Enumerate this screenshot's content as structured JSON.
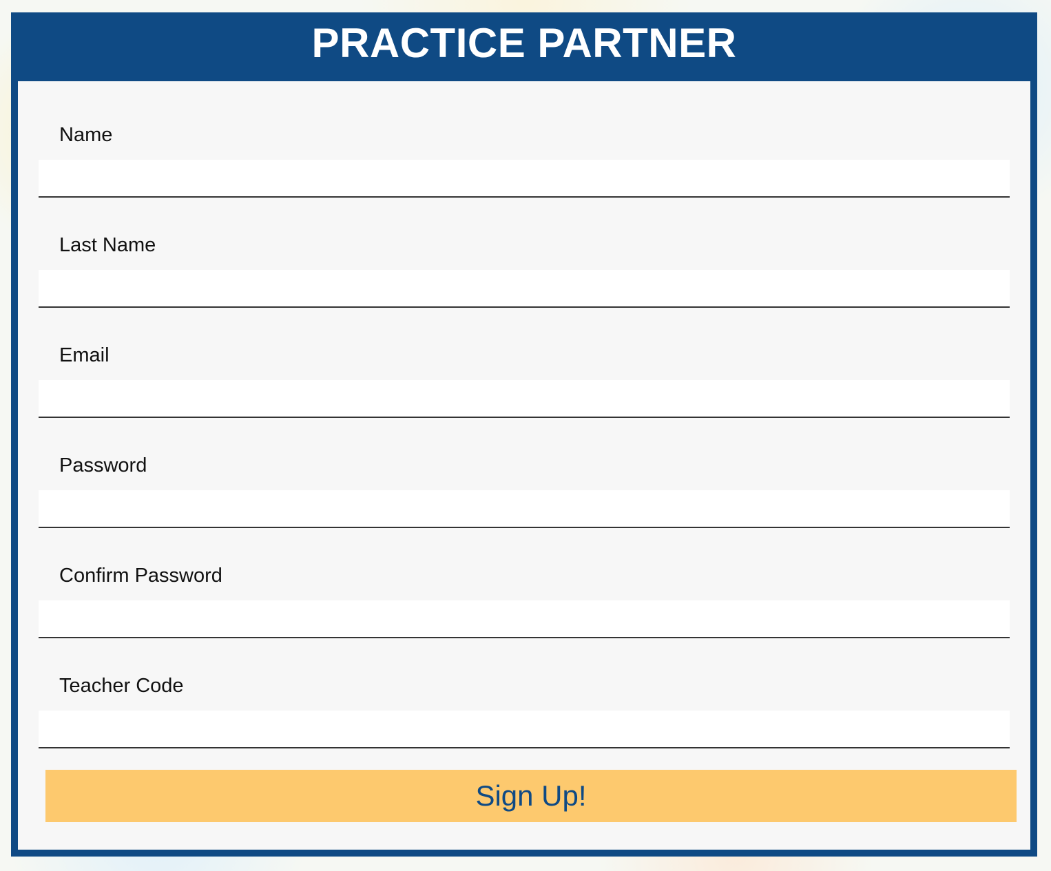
{
  "header": {
    "title": "PRACTICE PARTNER"
  },
  "form": {
    "fields": [
      {
        "label": "Name",
        "value": "",
        "placeholder": ""
      },
      {
        "label": "Last Name",
        "value": "",
        "placeholder": ""
      },
      {
        "label": "Email",
        "value": "",
        "placeholder": ""
      },
      {
        "label": "Password",
        "value": "",
        "placeholder": ""
      },
      {
        "label": "Confirm Password",
        "value": "",
        "placeholder": ""
      },
      {
        "label": "Teacher Code",
        "value": "",
        "placeholder": ""
      }
    ],
    "submit_label": "Sign Up!"
  },
  "colors": {
    "brand_blue": "#0f4a84",
    "button_yellow": "#fdc96e",
    "panel_gray": "#f7f7f7"
  }
}
